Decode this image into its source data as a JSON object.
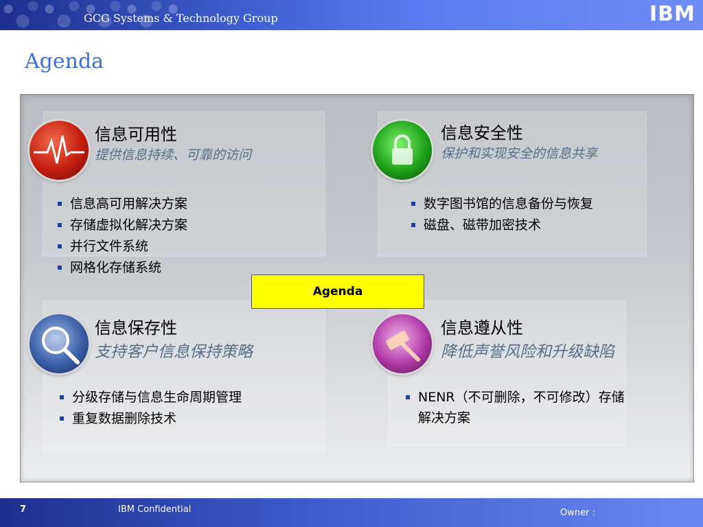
{
  "header": {
    "group_name": "GCG Systems & Technology Group",
    "logo_text": "IBM"
  },
  "page_title": "Agenda",
  "quadrants": [
    {
      "id": "availability",
      "title": "信息可用性",
      "subtitle": "提供信息持续、可靠的访问",
      "icon": "heartbeat-icon",
      "items": [
        "信息高可用解决方案",
        "存储虚拟化解决方案",
        "并行文件系统",
        "网格化存储系统"
      ]
    },
    {
      "id": "security",
      "title": "信息安全性",
      "subtitle": "保护和实现安全的信息共享",
      "icon": "lock-icon",
      "items": [
        "数字图书馆的信息备份与恢复",
        "磁盘、磁带加密技术"
      ]
    },
    {
      "id": "retention",
      "title": "信息保存性",
      "subtitle": "支持客户信息保持策略",
      "icon": "magnifier-icon",
      "items": [
        "分级存储与信息生命周期管理",
        "重复数据删除技术"
      ]
    },
    {
      "id": "compliance",
      "title": "信息遵从性",
      "subtitle": "降低声誉风险和升级缺陷",
      "icon": "gavel-icon",
      "items": [
        "NENR（不可删除，不可修改）存储",
        "解决方案"
      ]
    }
  ],
  "agenda_button": "Agenda",
  "footer": {
    "page_number": "7",
    "confidential": "IBM Confidential",
    "owner": "Owner :"
  },
  "colors": {
    "title": "#3a6fd8",
    "bullet": "#1d3fa8",
    "agenda_box": "#ffff00",
    "header": "#1d2f8e"
  }
}
